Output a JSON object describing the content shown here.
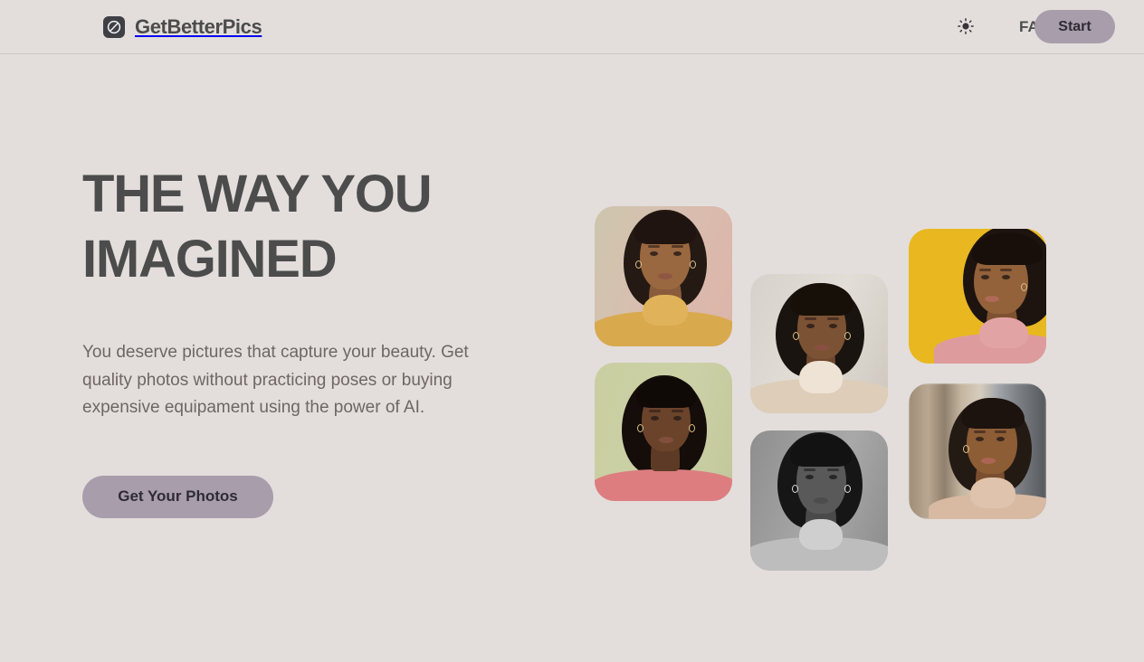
{
  "header": {
    "brand_name": "GetBetterPics",
    "brand_mark_icon": "lens-leaf-logo-icon",
    "theme_toggle_icon": "sun-icon",
    "nav_link_label": "FAQ",
    "start_button_label": "Start"
  },
  "hero": {
    "title_line1": "THE WAY YOU",
    "title_line2": "IMAGINED",
    "subtitle": "You deserve pictures that capture your beauty. Get quality photos without practicing poses or buying expensive equipament using the power of AI.",
    "cta_label": "Get Your Photos"
  },
  "collage": {
    "photos": [
      {
        "id": "card1",
        "alt": "portrait in mustard turtleneck on warm beige backdrop"
      },
      {
        "id": "card2",
        "alt": "portrait in coral ribbed top on sage green backdrop"
      },
      {
        "id": "card3",
        "alt": "portrait in cream knit turtleneck on off-white backdrop"
      },
      {
        "id": "card4",
        "alt": "black and white portrait in textured knit turtleneck"
      },
      {
        "id": "card5",
        "alt": "smiling portrait in pink turtleneck on yellow backdrop"
      },
      {
        "id": "card6",
        "alt": "smiling portrait in tan turtleneck on blurred street backdrop"
      }
    ]
  },
  "colors": {
    "page_background": "#e3dedc",
    "header_border": "#cfc8c6",
    "text_primary": "#4c4c4c",
    "text_secondary": "#6e6664",
    "accent_button": "#a79dab",
    "logo_background": "#3f3f46"
  }
}
